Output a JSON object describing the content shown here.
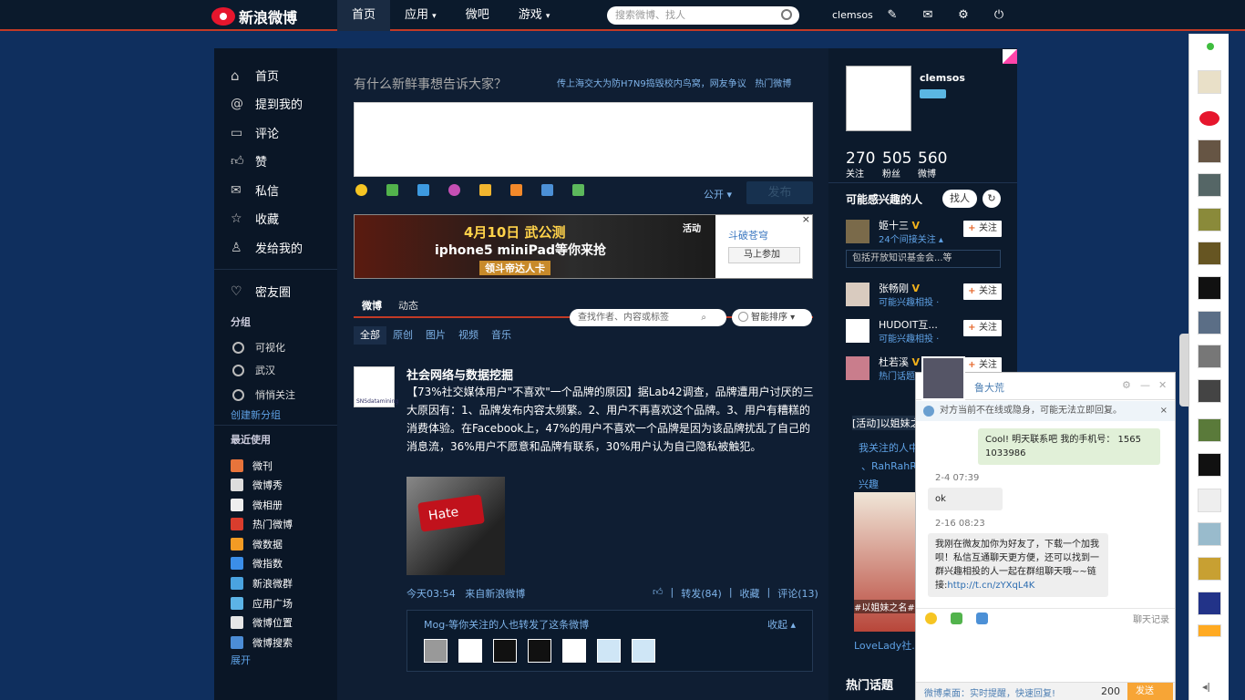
{
  "topbar": {
    "brand": "新浪微博",
    "nav": [
      "首页",
      "应用",
      "微吧",
      "游戏"
    ],
    "nav_arrows": "▾",
    "search_placeholder": "搜索微博、找人",
    "username": "clemsos"
  },
  "left_nav": {
    "main": [
      "首页",
      "提到我的",
      "评论",
      "赞",
      "私信",
      "收藏",
      "发给我的"
    ],
    "friends": "密友圈",
    "group_title": "分组",
    "groups": [
      "可视化",
      "武汉",
      "悄悄关注"
    ],
    "create_group": "创建新分组",
    "recent_title": "最近使用",
    "apps": [
      "微刊",
      "微博秀",
      "微相册",
      "热门微博",
      "微数据",
      "微指数",
      "新浪微群",
      "应用广场",
      "微博位置",
      "微博搜索"
    ],
    "expand": "展开"
  },
  "composer": {
    "prompt": "有什么新鲜事想告诉大家？",
    "hot_topic": "传上海交大为防H7N9捣毁校内鸟窝，网友争议",
    "hot_link": "热门微博",
    "visibility": "公开",
    "post": "发布"
  },
  "banner": {
    "line1": "4月10日 武公测",
    "line2": "iphone5 miniPad等你来抢",
    "line3": "领斗帝达人卡",
    "tag": "活动",
    "side_name": "斗破苍穹",
    "side_btn": "马上参加",
    "close": "×"
  },
  "feed_tabs": {
    "tabs": [
      "微博",
      "动态"
    ],
    "search_placeholder": "查找作者、内容或标签",
    "sort": "智能排序",
    "filters": [
      "全部",
      "原创",
      "图片",
      "视频",
      "音乐"
    ]
  },
  "post": {
    "author": "社会网络与数据挖掘",
    "avatar_label": "SNSdatamining",
    "text": "【73%社交媒体用户\"不喜欢\"一个品牌的原因】据Lab42调查，品牌遭用户讨厌的三大原因有：1、品牌发布内容太频繁。2、用户不再喜欢这个品牌。3、用户有糟糕的消费体验。在Facebook上，47%的用户不喜欢一个品牌是因为该品牌扰乱了自己的消息流，36%用户不愿意和品牌有联系，30%用户认为自己隐私被触犯。",
    "image_key": "Hate",
    "time": "今天03:54",
    "source": "来自新浪微博",
    "actions": [
      "转发(84)",
      "收藏",
      "评论(13)"
    ],
    "fwd_text": "Mog-等你关注的人也转发了这条微博",
    "fwd_collapse": "收起 ▴"
  },
  "profile": {
    "name": "clemsos",
    "stats": [
      {
        "n": "270",
        "l": "关注"
      },
      {
        "n": "505",
        "l": "粉丝"
      },
      {
        "n": "560",
        "l": "微博"
      }
    ]
  },
  "suggest": {
    "title": "可能感兴趣的人",
    "find": "找人",
    "follow": "关注",
    "people": [
      {
        "name": "姬十三",
        "desc": "24个间接关注 ▴"
      },
      {
        "name": "张畅刚",
        "desc": "可能兴趣相投 ·"
      },
      {
        "name": "HUDOIT互...",
        "desc": "可能兴趣相投 ·"
      },
      {
        "name": "杜若溪",
        "desc": "热门话题"
      }
    ],
    "tag_note": "包括开放知识基金会...等",
    "activity": "[活动]以姐妹之名",
    "act_desc1": "我关注的人中",
    "act_desc2": "、RahRahR",
    "act_desc3": "兴趣",
    "ad_caption": "#以姐妹之名# 赢取adidas装",
    "ad_link": "LoveLady社...",
    "hot_topics": "热门话题"
  },
  "chat": {
    "name": "鲁大荒",
    "notice": "对方当前不在线或隐身，可能无法立即回复。",
    "messages": [
      {
        "text": "Cool! 明天联系吧 我的手机号： 1565 1033986"
      },
      {
        "time": "2-4 07:39",
        "text": "ok"
      },
      {
        "time": "2-16 08:23",
        "text": "我刚在微友加你为好友了，下载一个加我呗！私信互通聊天更方便，还可以找到一群兴趣相投的人一起在群组聊天哦~~链接:",
        "link": "http://t.cn/zYXqL4K"
      }
    ],
    "history": "聊天记录",
    "footer_tip": "微博桌面：实时提醒，快速回复!",
    "count": "200",
    "send": "发送"
  }
}
